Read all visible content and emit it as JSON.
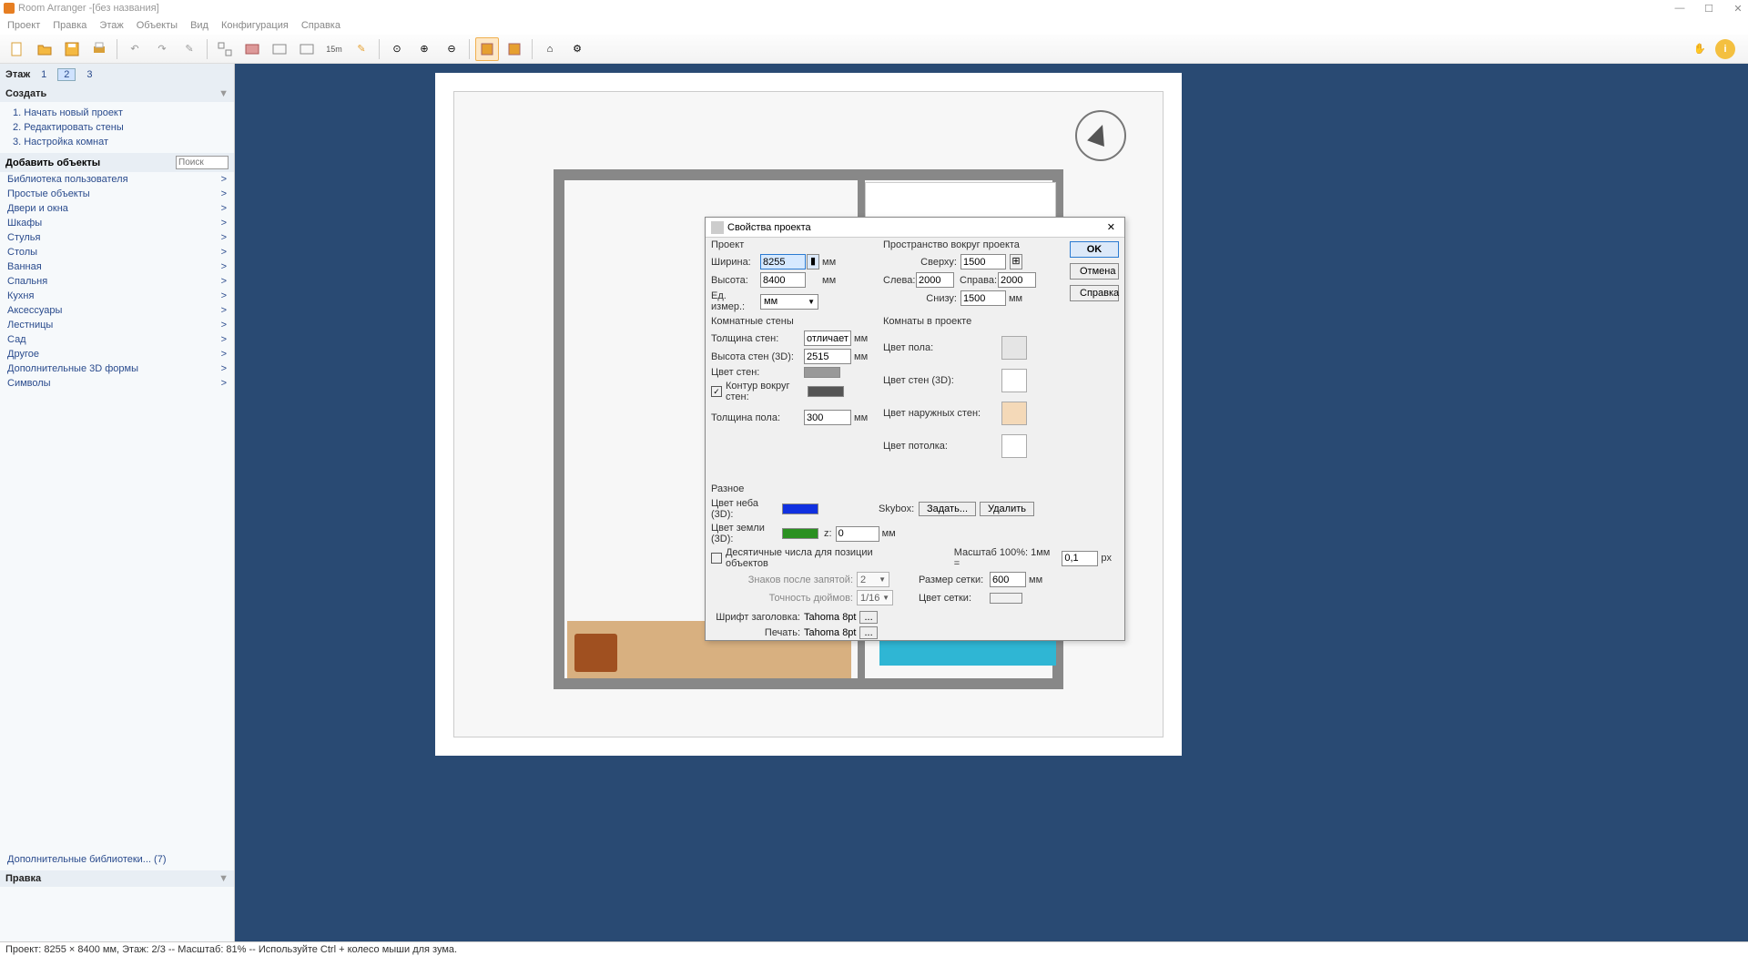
{
  "titlebar": {
    "app": "Room Arranger",
    "doc": "[без названия]"
  },
  "menu": [
    "Проект",
    "Правка",
    "Этаж",
    "Объекты",
    "Вид",
    "Конфигурация",
    "Справка"
  ],
  "floors": {
    "label": "Этаж",
    "items": [
      "1",
      "2",
      "3"
    ],
    "active": 1
  },
  "createPanel": {
    "title": "Создать",
    "items": [
      "1. Начать новый проект",
      "2. Редактировать стены",
      "3. Настройка комнат"
    ]
  },
  "addPanel": {
    "title": "Добавить объекты",
    "searchPlaceholder": "Поиск",
    "categories": [
      "Библиотека пользователя",
      "Простые объекты",
      "Двери и окна",
      "Шкафы",
      "Стулья",
      "Столы",
      "Ванная",
      "Спальня",
      "Кухня",
      "Аксессуары",
      "Лестницы",
      "Сад",
      "Другое",
      "Дополнительные 3D формы",
      "Символы"
    ]
  },
  "libs": "Дополнительные библиотеки... (7)",
  "editPanel": "Правка",
  "dialog": {
    "title": "Свойства проекта",
    "project": {
      "heading": "Проект",
      "widthLbl": "Ширина:",
      "width": "8255",
      "widthUnit": "мм",
      "heightLbl": "Высота:",
      "height": "8400",
      "heightUnit": "мм",
      "unitsLbl": "Ед. измер.:",
      "units": "мм"
    },
    "space": {
      "heading": "Пространство вокруг проекта",
      "topLbl": "Сверху:",
      "top": "1500",
      "leftLbl": "Слева:",
      "left": "2000",
      "rightLbl": "Справа:",
      "right": "2000",
      "bottomLbl": "Снизу:",
      "bottom": "1500",
      "bottomUnit": "мм"
    },
    "walls": {
      "heading": "Комнатные стены",
      "thickLbl": "Толщина стен:",
      "thick": "отличается.",
      "thickUnit": "мм",
      "h3dLbl": "Высота стен (3D):",
      "h3d": "2515",
      "h3dUnit": "мм",
      "colorLbl": "Цвет стен:",
      "outlineLbl": "Контур вокруг стен:",
      "floorThickLbl": "Толщина пола:",
      "floorThick": "300",
      "floorThickUnit": "мм"
    },
    "rooms": {
      "heading": "Комнаты в проекте",
      "floorColorLbl": "Цвет пола:",
      "wall3dLbl": "Цвет стен (3D):",
      "outerLbl": "Цвет наружных стен:",
      "ceilLbl": "Цвет потолка:"
    },
    "misc": {
      "heading": "Разное",
      "skyLbl": "Цвет неба (3D):",
      "groundLbl": "Цвет земли (3D):",
      "zLbl": "z:",
      "z": "0",
      "zUnit": "мм",
      "skyboxLbl": "Skybox:",
      "set": "Задать...",
      "del": "Удалить",
      "decimalLbl": "Десятичные числа для позиции объектов",
      "precLbl": "Знаков после запятой:",
      "prec": "2",
      "inchLbl": "Точность дюймов:",
      "inch": "1/16",
      "scaleLbl": "Масштаб 100%: 1мм =",
      "scale": "0,1",
      "scaleUnit": "px",
      "gridLbl": "Размер сетки:",
      "grid": "600",
      "gridUnit": "мм",
      "gridColorLbl": "Цвет сетки:",
      "fontHeadLbl": "Шрифт заголовка:",
      "fontHead": "Tahoma 8pt",
      "printLbl": "Печать:",
      "print": "Tahoma 8pt",
      "more": "..."
    },
    "buttons": {
      "ok": "OK",
      "cancel": "Отмена",
      "help": "Справка"
    }
  },
  "status": "Проект: 8255 × 8400 мм, Этаж: 2/3 -- Масштаб: 81% -- Используйте Ctrl + колесо мыши для зума."
}
